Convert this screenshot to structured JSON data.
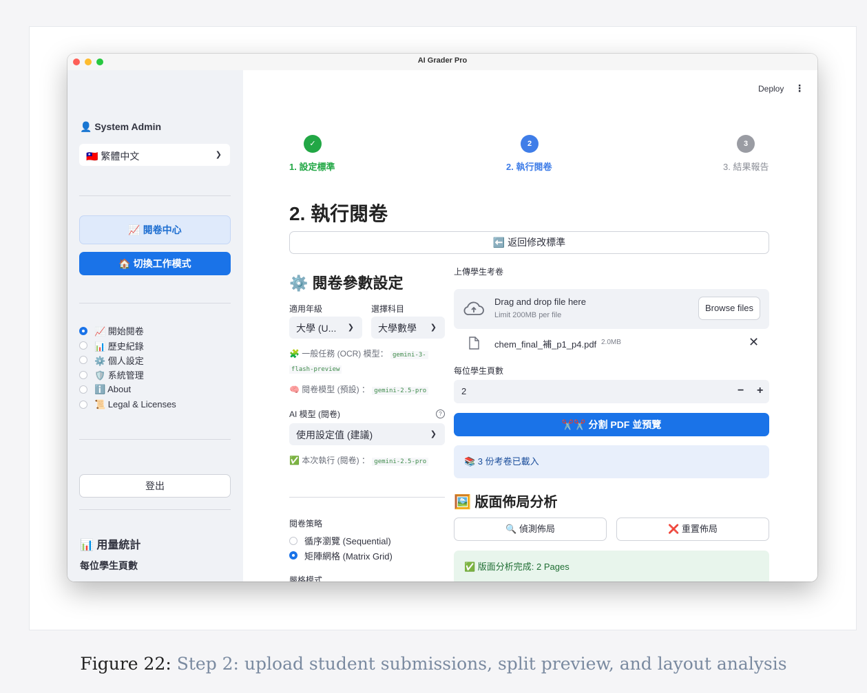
{
  "window": {
    "title": "AI Grader Pro"
  },
  "sidebar": {
    "user": "👤 System Admin",
    "language": "🇹🇼 繁體中文",
    "nav_active": "📈 閱卷中心",
    "switch_mode": "🏠 切換工作模式",
    "radio_items": [
      {
        "label": "📈 開始閱卷",
        "selected": true
      },
      {
        "label": "📊 歷史紀錄",
        "selected": false
      },
      {
        "label": "⚙️ 個人設定",
        "selected": false
      },
      {
        "label": "🛡️ 系統管理",
        "selected": false
      },
      {
        "label": "ℹ️ About",
        "selected": false
      },
      {
        "label": "📜 Legal & Licenses",
        "selected": false
      }
    ],
    "logout": "登出",
    "stats_title": "📊 用量統計",
    "per_student_pages": "每位學生頁數"
  },
  "header": {
    "deploy": "Deploy",
    "menu": "⋮"
  },
  "stepper": {
    "steps": [
      {
        "marker": "✓",
        "label": "1. 設定標準",
        "state": "done",
        "color": "#22a745"
      },
      {
        "marker": "2",
        "label": "2. 執行閱卷",
        "state": "active",
        "color": "#3f7de8"
      },
      {
        "marker": "3",
        "label": "3. 結果報告",
        "state": "pending",
        "color": "#9a9ca3"
      }
    ]
  },
  "main": {
    "title": "2. 執行閱卷",
    "back_button": "⬅️ 返回修改標準",
    "params": {
      "title": "⚙️ 閱卷參數設定",
      "grade_label": "適用年級",
      "grade_value": "大學 (U...",
      "subject_label": "選擇科目",
      "subject_value": "大學數學",
      "ocr_note": "🧩 一般任務 (OCR) 模型：",
      "ocr_model_1": "gemini-3-",
      "ocr_model_2": "flash-preview",
      "grading_note": "🧠 閱卷模型 (預設) ：",
      "grading_model": "gemini-2.5-pro",
      "ai_model_label": "AI 模型 (閱卷)",
      "ai_model_value": "使用設定值 (建議)",
      "exec_note": "✅ 本次執行 (閱卷) ：",
      "exec_model": "gemini-2.5-pro",
      "strategy_label": "閱卷策略",
      "strategy_options": [
        {
          "label": "循序瀏覽 (Sequential)",
          "selected": false
        },
        {
          "label": "矩陣網格 (Matrix Grid)",
          "selected": true
        }
      ],
      "strict_label": "嚴格模式"
    },
    "upload": {
      "label": "上傳學生考卷",
      "drop_text": "Drag and drop file here",
      "limit_text": "Limit 200MB per file",
      "browse": "Browse files",
      "file_name": "chem_final_補_p1_p4.pdf",
      "file_size": "2.0MB",
      "pages_label": "每位學生頁數",
      "pages_value": "2",
      "minus": "−",
      "plus": "+",
      "split_button": "✂️✂️ 分割 PDF 並預覽",
      "loaded_info": "📚 3 份考卷已載入"
    },
    "layout": {
      "title": "🖼️ 版面佈局分析",
      "detect_button": "🔍 偵測佈局",
      "reset_button": "❌ 重置佈局",
      "success": "✅ 版面分析完成: 2 Pages"
    }
  },
  "caption": {
    "figure": "Figure 22:",
    "text": "Step 2: upload student submissions, split preview, and layout analysis"
  }
}
